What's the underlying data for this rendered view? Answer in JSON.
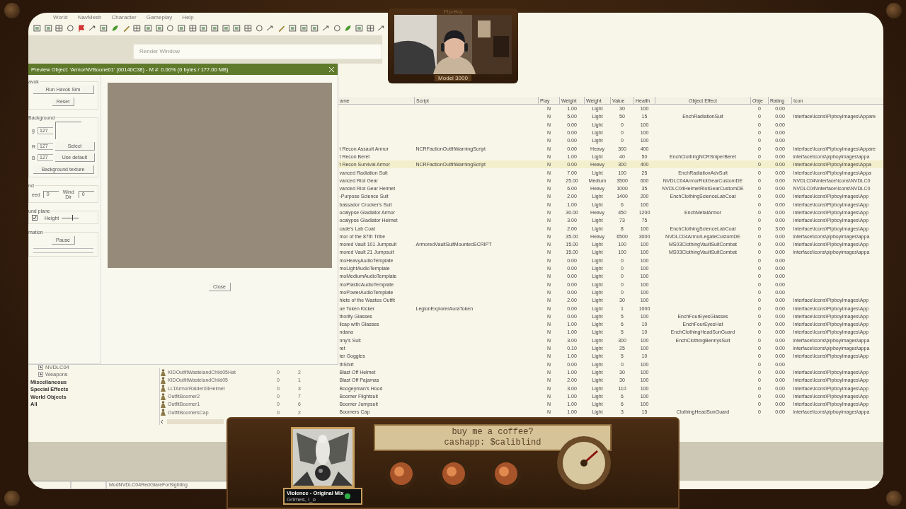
{
  "menu": [
    "World",
    "NavMesh",
    "Character",
    "Gameplay",
    "Help"
  ],
  "render_window": {
    "title": "Render Window"
  },
  "preview_dialog": {
    "title": "Preview Object: 'ArmorNVBoone01' (00140C38) - M #: 0.00% (0 bytes / 177.00 MB)",
    "havok": {
      "label": "avok",
      "buttons": [
        "Run Havok Sim",
        "Reset"
      ]
    },
    "background": {
      "label": "Background",
      "channels": [
        {
          "label": "g",
          "value": "127"
        },
        {
          "label": "R",
          "value": "127"
        },
        {
          "label": "B",
          "value": "127"
        }
      ],
      "buttons": [
        "Select",
        "Use default"
      ],
      "texture_button": "Background texture"
    },
    "wind": {
      "label": "nd",
      "speed_label": "eed",
      "speed": "0",
      "dir_label": "Wind Dir",
      "dir": "0"
    },
    "ground_plane": {
      "label": "und plane",
      "checked": true,
      "height_label": "Height",
      "level": 0.6
    },
    "animation": {
      "label": "mation",
      "button": "Pause"
    },
    "close": "Close"
  },
  "table": {
    "columns": [
      "ame",
      "Script",
      "Play",
      "Weight",
      "Weight",
      "Value",
      "Health",
      "Object Effect",
      "Obje",
      "Rating",
      "Icon"
    ],
    "rows": [
      {
        "selected": false,
        "cells": [
          null,
          null,
          "N",
          "1.00",
          "Light",
          "30",
          "100",
          null,
          "0",
          "0.00",
          null
        ]
      },
      {
        "selected": false,
        "cells": [
          null,
          null,
          "N",
          "5.00",
          "Light",
          "50",
          "15",
          "EnchRadiationSuit",
          "0",
          "0.00",
          "Interface\\Icons\\PipboyImages\\Appare"
        ]
      },
      {
        "selected": false,
        "cells": [
          null,
          null,
          "N",
          "0.00",
          "Light",
          "0",
          "100",
          null,
          "0",
          "0.00",
          null
        ]
      },
      {
        "selected": false,
        "cells": [
          null,
          null,
          "N",
          "0.00",
          "Light",
          "0",
          "100",
          null,
          "0",
          "0.00",
          null
        ]
      },
      {
        "selected": false,
        "cells": [
          null,
          null,
          "N",
          "0.00",
          "Light",
          "0",
          "100",
          null,
          "0",
          "0.00",
          null
        ]
      },
      {
        "selected": false,
        "cells": [
          "t Recon Assault Armor",
          "NCRFactionOutfitWarningScript",
          "N",
          "0.00",
          "Heavy",
          "300",
          "400",
          null,
          "0",
          "0.00",
          "Interface\\Icons\\PipboyImages\\Appare"
        ]
      },
      {
        "selected": false,
        "cells": [
          "t Recon Beret",
          null,
          "N",
          "1.00",
          "Light",
          "40",
          "50",
          "EnchClothingNCRSniperBeret",
          "0",
          "0.00",
          "interface\\icons\\pipboyimages\\appa"
        ]
      },
      {
        "selected": true,
        "cells": [
          "t Recon Survival Armor",
          "NCRFactionOutfitWarningScript",
          "N",
          "0.00",
          "Heavy",
          "300",
          "400",
          null,
          "0",
          "0.00",
          "Interface\\Icons\\PipboyImages\\Appa"
        ]
      },
      {
        "selected": false,
        "cells": [
          "vanced Radiation Suit",
          null,
          "N",
          "7.00",
          "Light",
          "100",
          "25",
          "EnchRadiationAdvSuit",
          "0",
          "0.00",
          "Interface\\Icons\\PipboyImages\\Appa"
        ]
      },
      {
        "selected": false,
        "cells": [
          "vanced Riot Gear",
          null,
          "N",
          "25.00",
          "Medium",
          "3500",
          "600",
          "NVDLC04ArmorRiotGearCustomDE",
          "0",
          "0.00",
          "NVDLC04\\Interface\\Icons\\NVDLC0"
        ]
      },
      {
        "selected": false,
        "cells": [
          "vanced Riot Gear Helmet",
          null,
          "N",
          "6.00",
          "Heavy",
          "1000",
          "35",
          "NVDLC04HelmetRiotGearCustomDE",
          "0",
          "0.00",
          "NVDLC04\\Interface\\Icons\\NVDLC0"
        ]
      },
      {
        "selected": false,
        "cells": [
          "-Purpose Science Suit",
          null,
          "N",
          "2.00",
          "Light",
          "1400",
          "200",
          "EnchClothingScienceLabCoat",
          "0",
          "0.00",
          "Interface\\Icons\\PipboyImages\\App"
        ]
      },
      {
        "selected": false,
        "cells": [
          "bassador Crocker's Suit",
          null,
          "N",
          "1.00",
          "Light",
          "6",
          "100",
          null,
          "0",
          "0.00",
          "Interface\\Icons\\PipboyImages\\App"
        ]
      },
      {
        "selected": false,
        "cells": [
          "ocalypse Gladiator Armor",
          null,
          "N",
          "30.00",
          "Heavy",
          "450",
          "1200",
          "EnchMetalArmor",
          "0",
          "0.00",
          "Interface\\Icons\\PipboyImages\\App"
        ]
      },
      {
        "selected": false,
        "cells": [
          "ocalypse Gladiator Helmet",
          null,
          "N",
          "3.00",
          "Light",
          "73",
          "75",
          null,
          "0",
          "0.00",
          "Interface\\Icons\\PipboyImages\\App"
        ]
      },
      {
        "selected": false,
        "cells": [
          "cade's Lab Coat",
          null,
          "N",
          "2.00",
          "Light",
          "8",
          "100",
          "EnchClothingScienceLabCoat",
          "0",
          "3.00",
          "Interface\\Icons\\PipboyImages\\App"
        ]
      },
      {
        "selected": false,
        "cells": [
          "mor of the 87th Tribe",
          null,
          "N",
          "35.00",
          "Heavy",
          "6500",
          "3000",
          "NVDLC04ArmorLegateCustomDE",
          "0",
          "0.00",
          "interface\\icons\\pipboyimages\\appa"
        ]
      },
      {
        "selected": false,
        "cells": [
          "mored Vault 101 Jumpsuit",
          "ArmoredVaultSuitMountedSCRIPT",
          "N",
          "15.00",
          "Light",
          "100",
          "100",
          "MS03ClothingVaultSuitCombat",
          "0",
          "0.00",
          "Interface\\Icons\\PipboyImages\\App"
        ]
      },
      {
        "selected": false,
        "cells": [
          "mored Vault 21 Jumpsuit",
          null,
          "N",
          "15.00",
          "Light",
          "100",
          "100",
          "MS03ClothingVaultSuitCombat",
          "0",
          "0.00",
          "interface\\icons\\pipboyimages\\appa"
        ]
      },
      {
        "selected": false,
        "cells": [
          "moHeavyAudioTemplate",
          null,
          "N",
          "0.00",
          "Light",
          "0",
          "100",
          null,
          "0",
          "0.00",
          null
        ]
      },
      {
        "selected": false,
        "cells": [
          "moLightAudioTemplate",
          null,
          "N",
          "0.00",
          "Light",
          "0",
          "100",
          null,
          "0",
          "0.00",
          null
        ]
      },
      {
        "selected": false,
        "cells": [
          "moMediumAudioTemplate",
          null,
          "N",
          "0.00",
          "Light",
          "0",
          "100",
          null,
          "0",
          "0.00",
          null
        ]
      },
      {
        "selected": false,
        "cells": [
          "moPlasticAudioTemplate",
          null,
          "N",
          "0.00",
          "Light",
          "0",
          "100",
          null,
          "0",
          "0.00",
          null
        ]
      },
      {
        "selected": false,
        "cells": [
          "moPowerAudioTemplate",
          null,
          "N",
          "0.00",
          "Light",
          "0",
          "100",
          null,
          "0",
          "0.00",
          null
        ]
      },
      {
        "selected": false,
        "cells": [
          "hlete of the Wastes Outfit",
          null,
          "N",
          "2.00",
          "Light",
          "30",
          "100",
          null,
          "0",
          "0.00",
          "Interface\\Icons\\PipboyImages\\App"
        ]
      },
      {
        "selected": false,
        "cells": [
          "ue Token Kicker",
          "LegionExplorerAuraToken",
          "N",
          "0.00",
          "Light",
          "1",
          "1000",
          null,
          "0",
          "0.00",
          "Interface\\Icons\\PipboyImages\\App"
        ]
      },
      {
        "selected": false,
        "cells": [
          "thority Glasses",
          null,
          "N",
          "0.00",
          "Light",
          "5",
          "100",
          "EnchFourEyesGlasses",
          "0",
          "0.00",
          "Interface\\Icons\\PipboyImages\\App"
        ]
      },
      {
        "selected": false,
        "cells": [
          "llcap with Glasses",
          null,
          "N",
          "1.00",
          "Light",
          "6",
          "10",
          "EnchFourEyesHat",
          "0",
          "0.00",
          "Interface\\Icons\\PipboyImages\\App"
        ]
      },
      {
        "selected": false,
        "cells": [
          "ndana",
          null,
          "N",
          "1.00",
          "Light",
          "5",
          "10",
          "EnchClothingHeadSunGuard",
          "0",
          "0.00",
          "Interface\\Icons\\PipboyImages\\App"
        ]
      },
      {
        "selected": false,
        "cells": [
          "nny's Suit",
          null,
          "N",
          "3.00",
          "Light",
          "300",
          "100",
          "EnchClothingBennysSuit",
          "0",
          "0.00",
          "interface\\icons\\pipboyimages\\appa"
        ]
      },
      {
        "selected": false,
        "cells": [
          "ret",
          null,
          "N",
          "0.10",
          "Light",
          "25",
          "100",
          null,
          "0",
          "0.00",
          "interface\\icons\\pipboyimages\\appa"
        ]
      },
      {
        "selected": false,
        "cells": [
          "ter Goggles",
          null,
          "N",
          "1.00",
          "Light",
          "5",
          "10",
          null,
          "0",
          "0.00",
          "Interface\\Icons\\PipboyImages\\App"
        ]
      },
      {
        "selected": false,
        "cells": [
          "thShirt",
          null,
          "N",
          "0.00",
          "Light",
          "0",
          "100",
          null,
          "0",
          "0.00",
          null
        ]
      },
      {
        "selected": false,
        "cells": [
          "Blast Off Helmet",
          null,
          "N",
          "1.00",
          "Light",
          "30",
          "100",
          null,
          "0",
          "0.00",
          "Interface\\Icons\\PipboyImages\\App"
        ]
      },
      {
        "selected": false,
        "cells": [
          "Blast Off Pajamas",
          null,
          "N",
          "2.00",
          "Light",
          "30",
          "100",
          null,
          "0",
          "0.00",
          "Interface\\Icons\\PipboyImages\\App"
        ]
      },
      {
        "selected": false,
        "cells": [
          "Boogeyman's Hood",
          null,
          "N",
          "3.00",
          "Light",
          "110",
          "100",
          null,
          "0",
          "0.00",
          "Interface\\Icons\\PipboyImages\\App"
        ]
      },
      {
        "selected": false,
        "cells": [
          "Boomer Flightsuit",
          null,
          "N",
          "1.00",
          "Light",
          "6",
          "100",
          null,
          "0",
          "0.00",
          "Interface\\Icons\\PipboyImages\\App"
        ]
      },
      {
        "selected": false,
        "cells": [
          "Boomer Jumpsuit",
          null,
          "N",
          "1.00",
          "Light",
          "6",
          "100",
          null,
          "0",
          "0.00",
          "Interface\\Icons\\PipboyImages\\App"
        ]
      },
      {
        "selected": false,
        "cells": [
          "Boomers Cap",
          null,
          "N",
          "1.00",
          "Light",
          "3",
          "15",
          "ClothingHeadSunGuard",
          "0",
          "0.00",
          "interface\\icons\\pipboyimages\\appa"
        ]
      }
    ]
  },
  "tree": [
    {
      "kind": "folder",
      "label": "NVDLC04"
    },
    {
      "kind": "folder",
      "label": "Weapons"
    },
    {
      "kind": "category",
      "label": "Miscellaneous"
    },
    {
      "kind": "category",
      "label": "Special Effects"
    },
    {
      "kind": "category",
      "label": "World Objects"
    },
    {
      "kind": "category",
      "label": "All"
    }
  ],
  "form_list": [
    {
      "editor_id": "KIDOutfitWastelandChild05Hat",
      "count": "0",
      "users": "2"
    },
    {
      "editor_id": "KIDOutfitWastelandChild05",
      "count": "0",
      "users": "1"
    },
    {
      "editor_id": "LLTArmorRaider03Helmet",
      "count": "0",
      "users": "3"
    },
    {
      "editor_id": "OutfitBoomer2",
      "count": "0",
      "users": "7"
    },
    {
      "editor_id": "OutfitBoomer1",
      "count": "0",
      "users": "6"
    },
    {
      "editor_id": "OutfitBoomersCap",
      "count": "0",
      "users": "2"
    }
  ],
  "status_bar": [
    "ModNVDLC04RedGlareForSighting"
  ],
  "webcam": {
    "title": "Pip-Boy",
    "label": "Model 3000"
  },
  "overlay": {
    "sign": [
      "buy me a coffee?",
      "cashapp: $caliblind"
    ],
    "now_playing": {
      "title": "Violence - Original Mix",
      "artist": "Grimes, i_o"
    }
  }
}
